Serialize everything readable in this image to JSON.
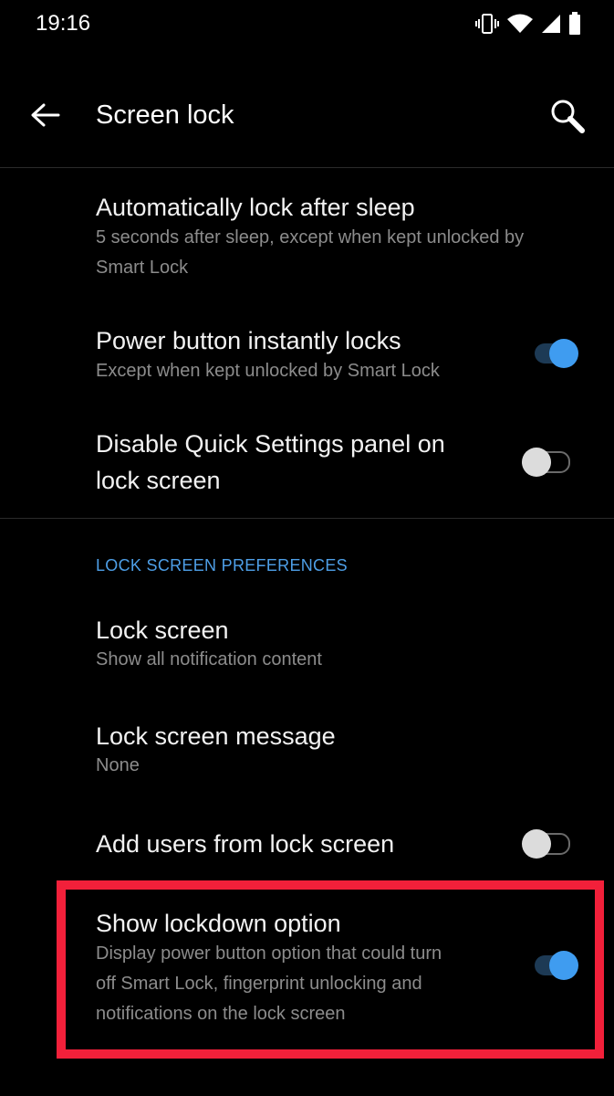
{
  "status_bar": {
    "time": "19:16",
    "icons": [
      "vibrate-icon",
      "wifi-icon",
      "signal-icon",
      "battery-icon"
    ]
  },
  "header": {
    "title": "Screen lock",
    "back_icon": "back-arrow-icon",
    "search_icon": "search-icon"
  },
  "items": {
    "auto_lock": {
      "title": "Automatically lock after sleep",
      "subtitle_line1": "5 seconds after sleep, except when kept unlocked by",
      "subtitle_line2": "Smart Lock"
    },
    "power_button": {
      "title": "Power button instantly locks",
      "subtitle": "Except when kept unlocked by Smart Lock",
      "enabled": true
    },
    "disable_qs": {
      "title_line1": "Disable Quick Settings panel on",
      "title_line2": "lock screen",
      "enabled": false
    }
  },
  "section_header": "LOCK SCREEN PREFERENCES",
  "prefs": {
    "lock_screen": {
      "title": "Lock screen",
      "subtitle": "Show all notification content"
    },
    "lock_message": {
      "title": "Lock screen message",
      "subtitle": "None"
    },
    "add_users": {
      "title": "Add users from lock screen",
      "enabled": false
    },
    "lockdown": {
      "title": "Show lockdown option",
      "subtitle_line1": "Display power button option that could turn",
      "subtitle_line2": "off Smart Lock, fingerprint unlocking and",
      "subtitle_line3": "notifications on the lock screen",
      "enabled": true
    }
  },
  "colors": {
    "accent": "#3f9cf0",
    "section": "#4e9fe7",
    "highlight": "#f2203a",
    "background": "#000000"
  }
}
